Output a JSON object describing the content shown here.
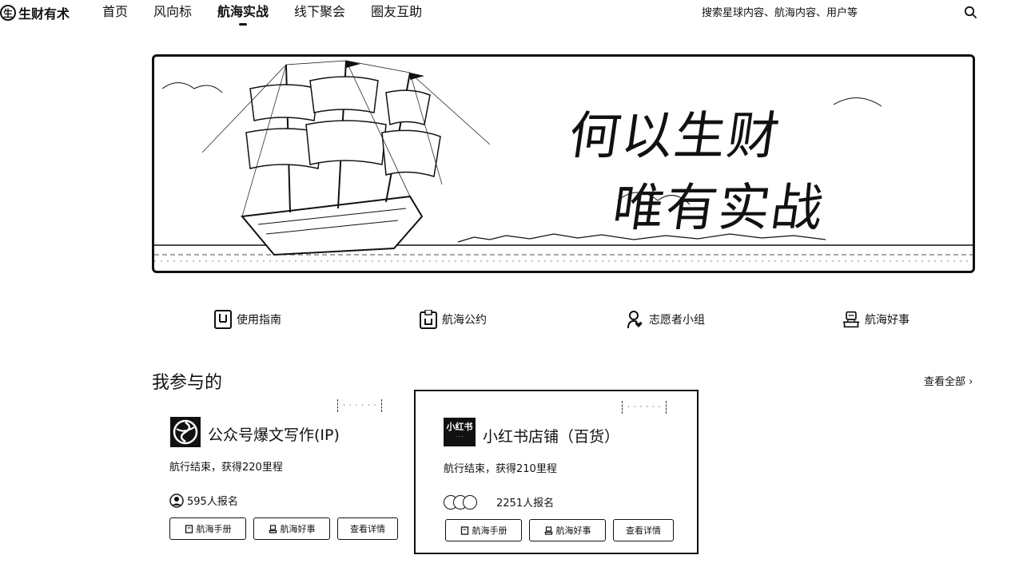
{
  "header": {
    "logo_text": "生财有术",
    "nav": [
      {
        "label": "首页",
        "active": false
      },
      {
        "label": "风向标",
        "active": false
      },
      {
        "label": "航海实战",
        "active": true
      },
      {
        "label": "线下聚会",
        "active": false
      },
      {
        "label": "圈友互助",
        "active": false
      }
    ],
    "search_placeholder": "搜索星球内容、航海内容、用户等"
  },
  "banner": {
    "line1": "何以生财",
    "line2": "唯有实战"
  },
  "quick_links": [
    {
      "label": "使用指南",
      "icon": "guide-icon"
    },
    {
      "label": "航海公约",
      "icon": "convention-icon"
    },
    {
      "label": "志愿者小组",
      "icon": "volunteer-icon"
    },
    {
      "label": "航海好事",
      "icon": "good-news-icon"
    }
  ],
  "section": {
    "title": "我参与的",
    "see_all": "查看全部 ›"
  },
  "cards": [
    {
      "title": "公众号爆文写作(IP)",
      "status": "航行结束，获得220里程",
      "signup": "595人报名",
      "buttons": [
        "航海手册",
        "航海好事",
        "查看详情"
      ],
      "selected": false
    },
    {
      "title": "小红书店铺（百货）",
      "icon_text": "小红书",
      "status": "航行结束，获得210里程",
      "signup": "2251人报名",
      "buttons": [
        "航海手册",
        "航海好事",
        "查看详情"
      ],
      "selected": true
    }
  ]
}
